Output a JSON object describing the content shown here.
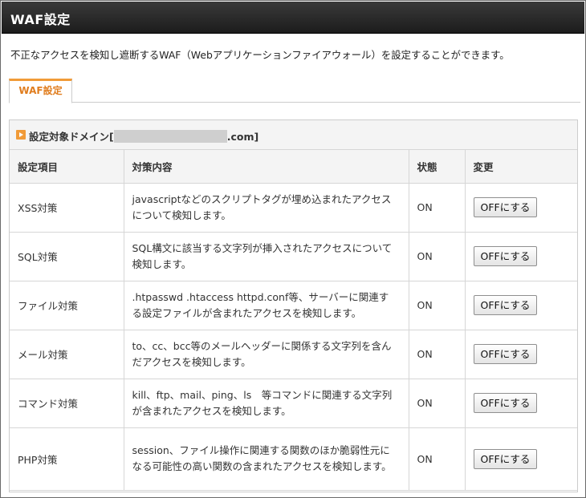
{
  "header": {
    "title": "WAF設定"
  },
  "description": "不正なアクセスを検知し遮断するWAF（Webアプリケーションファイアウォール）を設定することができます。",
  "tabs": [
    {
      "label": "WAF設定"
    }
  ],
  "panel": {
    "heading_prefix": "設定対象ドメイン[",
    "heading_suffix": ".com]"
  },
  "table": {
    "headers": [
      "設定項目",
      "対策内容",
      "状態",
      "変更"
    ],
    "rows": [
      {
        "item": "XSS対策",
        "content": "javascriptなどのスクリプトタグが埋め込まれたアクセスについて検知します。",
        "status": "ON",
        "button": "OFFにする"
      },
      {
        "item": "SQL対策",
        "content": "SQL構文に該当する文字列が挿入されたアクセスについて検知します。",
        "status": "ON",
        "button": "OFFにする"
      },
      {
        "item": "ファイル対策",
        "content": ".htpasswd .htaccess httpd.conf等、サーバーに関連する設定ファイルが含まれたアクセスを検知します。",
        "status": "ON",
        "button": "OFFにする"
      },
      {
        "item": "メール対策",
        "content": "to、cc、bcc等のメールヘッダーに関係する文字列を含んだアクセスを検知します。",
        "status": "ON",
        "button": "OFFにする"
      },
      {
        "item": "コマンド対策",
        "content": "kill、ftp、mail、ping、ls　等コマンドに関連する文字列が含まれたアクセスを検知します。",
        "status": "ON",
        "button": "OFFにする"
      },
      {
        "item": "PHP対策",
        "content": "session、ファイル操作に関連する関数のほか脆弱性元になる可能性の高い関数の含まれたアクセスを検知します。",
        "status": "ON",
        "button": "OFFにする"
      }
    ]
  },
  "colors": {
    "accent": "#f19b38",
    "title_bar": "#222222",
    "masked_domain": "#cfcfcf"
  }
}
